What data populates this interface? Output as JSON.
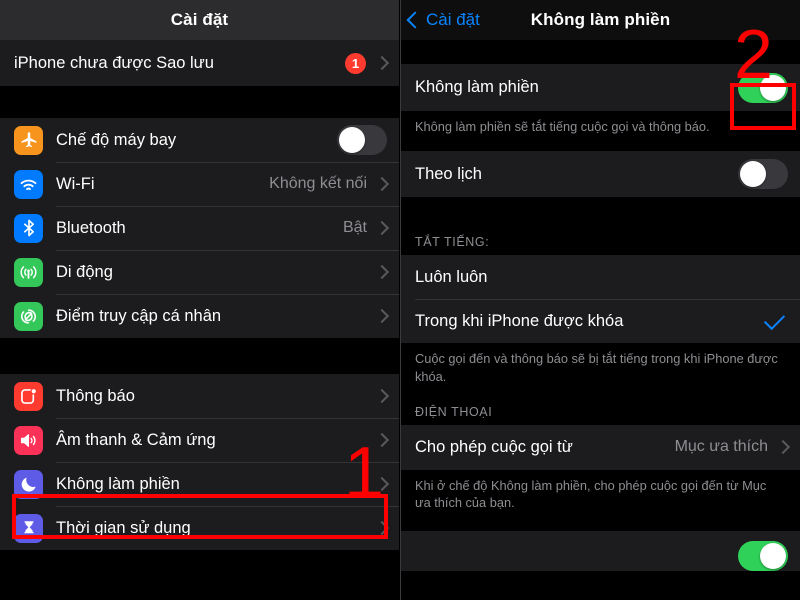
{
  "colors": {
    "accent_blue": "#0a84ff",
    "toggle_on_green": "#30d158",
    "badge_red": "#ff3b30",
    "annotation_red": "#ff0000",
    "row_bg": "#1c1c1e",
    "page_bg": "#000000",
    "secondary_text": "#8e8e93"
  },
  "left_panel": {
    "header": {
      "title": "Cài đặt"
    },
    "backup_row": {
      "label": "iPhone chưa được Sao lưu",
      "badge": "1",
      "chevron": "chevron-right-icon"
    },
    "connectivity": [
      {
        "label": "Chế độ máy bay",
        "icon": "airplane-icon",
        "icon_color": "#f7941d",
        "control": "toggle",
        "toggle_on": false
      },
      {
        "label": "Wi-Fi",
        "icon": "wifi-icon",
        "icon_color": "#007aff",
        "control": "value",
        "value": "Không kết nối"
      },
      {
        "label": "Bluetooth",
        "icon": "bluetooth-icon",
        "icon_color": "#007aff",
        "control": "value",
        "value": "Bật"
      },
      {
        "label": "Di động",
        "icon": "cellular-icon",
        "icon_color": "#34c759",
        "control": "value",
        "value": ""
      },
      {
        "label": "Điểm truy cập cá nhân",
        "icon": "hotspot-icon",
        "icon_color": "#34c759",
        "control": "value",
        "value": ""
      }
    ],
    "preferences": [
      {
        "label": "Thông báo",
        "icon": "notifications-icon",
        "icon_color": "#ff3b30",
        "control": "value",
        "value": ""
      },
      {
        "label": "Âm thanh & Cảm ứng",
        "icon": "sounds-icon",
        "icon_color": "#fc3158",
        "control": "value",
        "value": ""
      },
      {
        "label": "Không làm phiền",
        "icon": "moon-icon",
        "icon_color": "#5e5ce6",
        "control": "value",
        "value": ""
      },
      {
        "label": "Thời gian sử dụng",
        "icon": "hourglass-icon",
        "icon_color": "#5e5ce6",
        "control": "value",
        "value": ""
      }
    ]
  },
  "right_panel": {
    "header": {
      "back_label": "Cài đặt",
      "back_icon": "chevron-left-icon",
      "title": "Không làm phiền"
    },
    "dnd_row": {
      "label": "Không làm phiền",
      "toggle_on": true
    },
    "dnd_footer": "Không làm phiền sẽ tắt tiếng cuộc gọi và thông báo.",
    "schedule_row": {
      "label": "Theo lịch",
      "toggle_on": false
    },
    "silence_section": {
      "header": "TẮT TIẾNG:",
      "options": [
        {
          "label": "Luôn luôn",
          "selected": false
        },
        {
          "label": "Trong khi iPhone được khóa",
          "selected": true
        }
      ],
      "footer": "Cuộc gọi đến và thông báo sẽ bị tắt tiếng trong khi iPhone được khóa."
    },
    "phone_section": {
      "header": "ĐIỆN THOẠI",
      "allow_calls_row": {
        "label": "Cho phép cuộc gọi từ",
        "value": "Mục ưa thích"
      },
      "footer": "Khi ở chế độ Không làm phiền, cho phép cuộc gọi đến từ Mục ưa thích của bạn."
    },
    "partial_row": {
      "toggle_on": true
    }
  },
  "annotations": [
    {
      "name": "step-1",
      "number": "1"
    },
    {
      "name": "step-2",
      "number": "2"
    }
  ]
}
